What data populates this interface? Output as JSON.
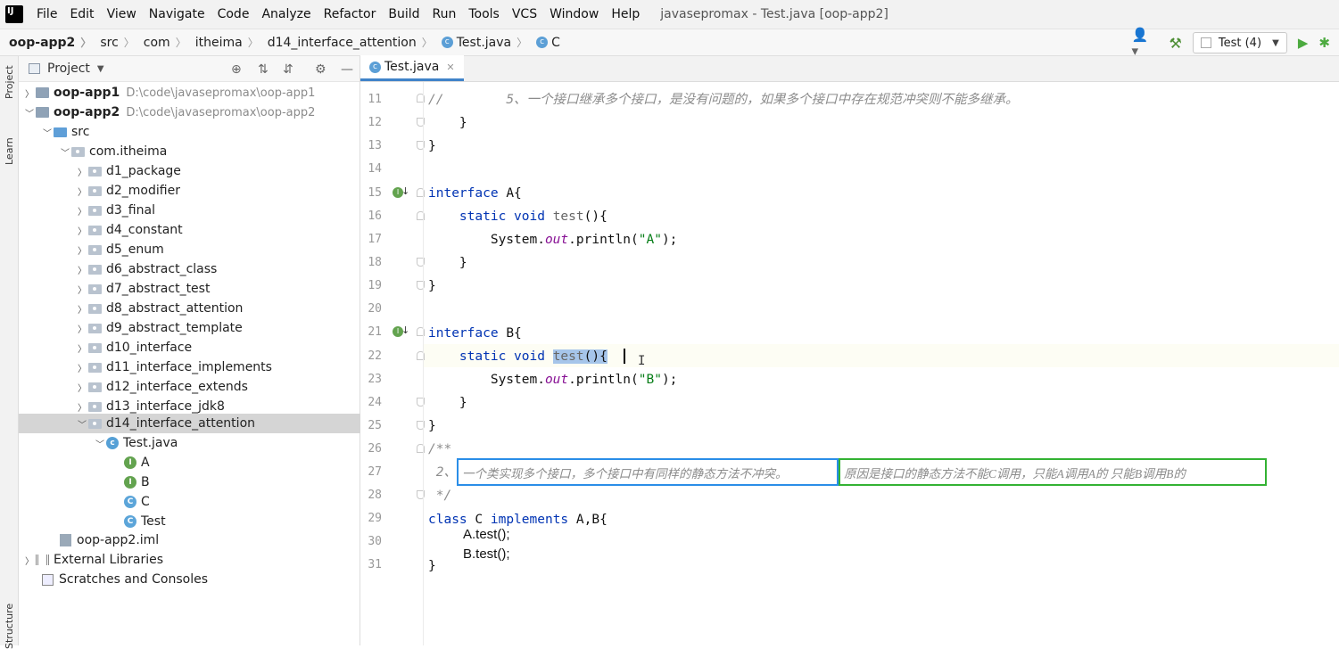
{
  "menubar": {
    "logo_text": "IJ",
    "items": [
      "File",
      "Edit",
      "View",
      "Navigate",
      "Code",
      "Analyze",
      "Refactor",
      "Build",
      "Run",
      "Tools",
      "VCS",
      "Window",
      "Help"
    ],
    "window_title": "javasepromax - Test.java [oop-app2]"
  },
  "navbar": {
    "crumbs": [
      "oop-app2",
      "src",
      "com",
      "itheima",
      "d14_interface_attention",
      "Test.java",
      "C"
    ],
    "run_config": "Test (4)"
  },
  "stripe": {
    "project": "Project",
    "learn": "Learn",
    "structure": "Structure"
  },
  "project_panel": {
    "title": "Project",
    "tree": [
      {
        "label": "oop-app1",
        "path": "D:\\code\\javasepromax\\oop-app1"
      },
      {
        "label": "oop-app2",
        "path": "D:\\code\\javasepromax\\oop-app2"
      },
      {
        "label": "src"
      },
      {
        "label": "com.itheima"
      },
      {
        "label": "d1_package"
      },
      {
        "label": "d2_modifier"
      },
      {
        "label": "d3_final"
      },
      {
        "label": "d4_constant"
      },
      {
        "label": "d5_enum"
      },
      {
        "label": "d6_abstract_class"
      },
      {
        "label": "d7_abstract_test"
      },
      {
        "label": "d8_abstract_attention"
      },
      {
        "label": "d9_abstract_template"
      },
      {
        "label": "d10_interface"
      },
      {
        "label": "d11_interface_implements"
      },
      {
        "label": "d12_interface_extends"
      },
      {
        "label": "d13_interface_jdk8"
      },
      {
        "label": "d14_interface_attention"
      },
      {
        "label": "Test.java"
      },
      {
        "label": "A"
      },
      {
        "label": "B"
      },
      {
        "label": "C"
      },
      {
        "label": "Test"
      },
      {
        "label": "oop-app2.iml"
      },
      {
        "label": "External Libraries"
      },
      {
        "label": "Scratches and Consoles"
      }
    ]
  },
  "editor": {
    "tab": "Test.java",
    "line_numbers": [
      "11",
      "12",
      "13",
      "14",
      "15",
      "16",
      "17",
      "18",
      "19",
      "20",
      "21",
      "22",
      "23",
      "24",
      "25",
      "26",
      "27",
      "28",
      "29",
      "30",
      "31"
    ],
    "l11": "5、一个接口继承多个接口，是没有问题的，如果多个接口中存在规范冲突则不能多继承。",
    "l11_prefix": "//",
    "brace_close": "}",
    "kw_interface": "interface",
    "name_a": "A{",
    "name_b": "B{",
    "kw_static": "static",
    "kw_void": "void",
    "method": "test",
    "paren": "(){",
    "sys": "System.",
    "out": "out",
    "println": ".println(",
    "str_a": "\"A\"",
    "str_b": "\"B\"",
    "end_call": ");",
    "doc_open": "/**",
    "doc_2": "2、",
    "doc_close": "*/",
    "kw_class": "class",
    "class_name": "C",
    "kw_implements": "implements",
    "impl_list": "A,B{",
    "call_a": "A.test();",
    "call_b": "B.test();",
    "note_blue": "一个类实现多个接口，多个接口中有同样的静态方法不冲突。",
    "note_green": "原因是接口的静态方法不能C调用，只能A调用A的   只能B调用B的",
    "ibeam": "I"
  }
}
